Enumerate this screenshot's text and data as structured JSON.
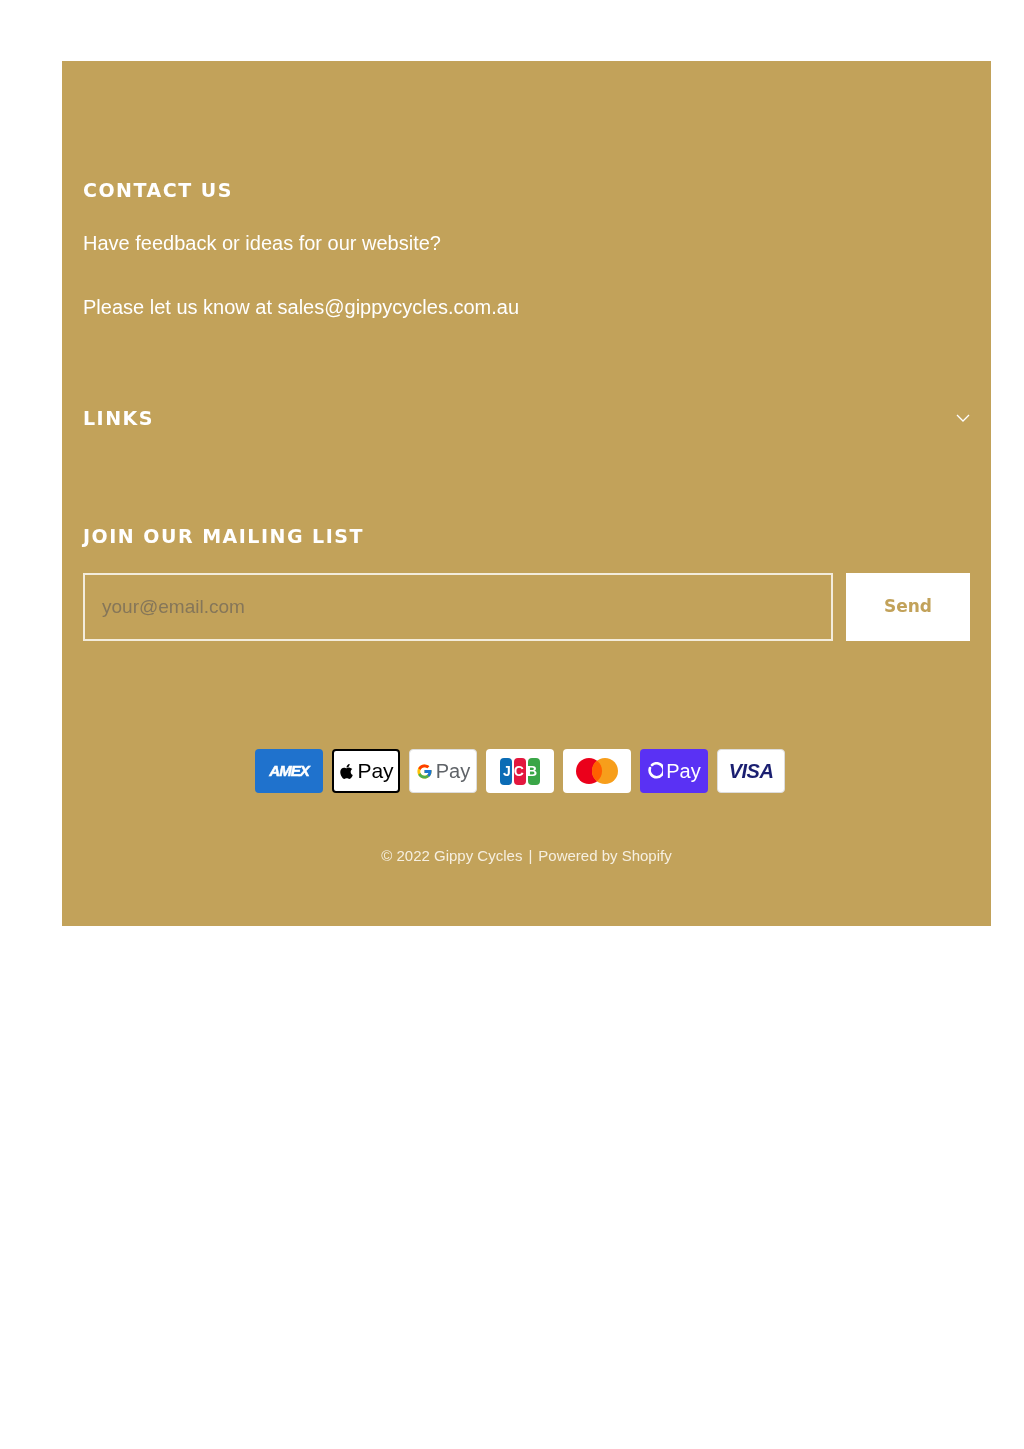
{
  "contact": {
    "heading": "CONTACT US",
    "paragraphs": [
      "Have feedback or ideas for our website?",
      "Please let us know at sales@gippycycles.com.au"
    ]
  },
  "links": {
    "heading": "LINKS",
    "expanded": false
  },
  "mailing_list": {
    "heading": "JOIN OUR MAILING LIST",
    "placeholder": "your@email.com",
    "button": "Send"
  },
  "payment_icons": [
    {
      "kind": "amex",
      "label": "AMEX"
    },
    {
      "kind": "apple_pay",
      "label": "Pay"
    },
    {
      "kind": "google_pay",
      "label": "Pay"
    },
    {
      "kind": "jcb",
      "label": "JCB"
    },
    {
      "kind": "mastercard"
    },
    {
      "kind": "opay",
      "label": "Pay"
    },
    {
      "kind": "visa",
      "label": "VISA"
    }
  ],
  "footer": {
    "copyright": "© 2022 Gippy Cycles",
    "separator": "|",
    "powered_by": "Powered by Shopify"
  }
}
